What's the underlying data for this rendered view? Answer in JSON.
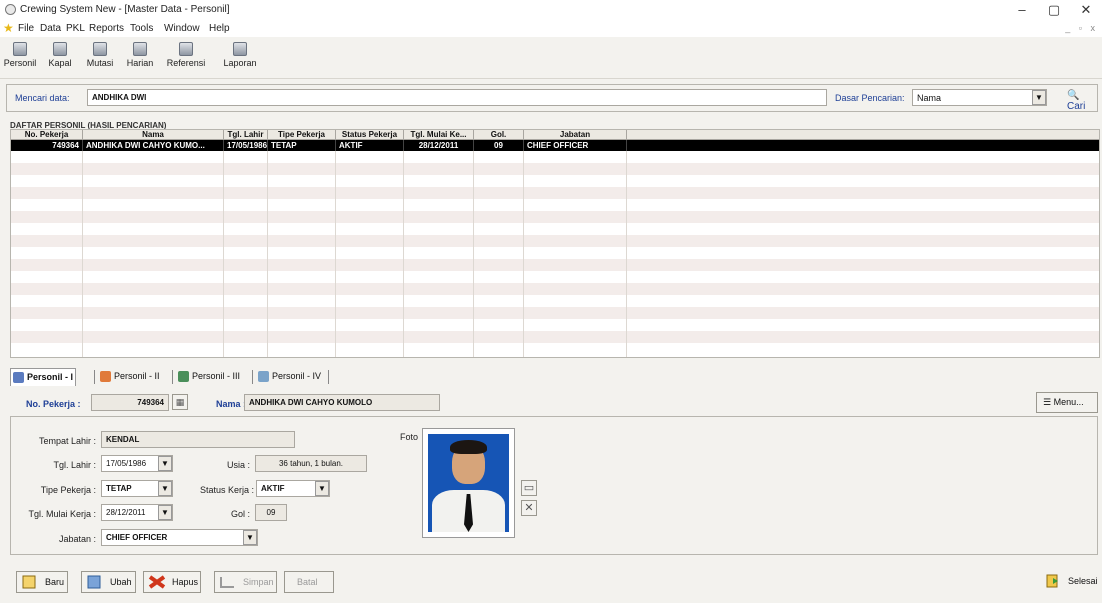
{
  "window": {
    "title": "Crewing System New - [Master Data - Personil]",
    "minimize": "–",
    "maximize": "▢",
    "close": "✕"
  },
  "menu": [
    "File",
    "Data",
    "PKL",
    "Reports",
    "Tools",
    "Window",
    "Help"
  ],
  "mdi_controls": "_ ▫ x",
  "toolbar": [
    "Personil",
    "Kapal",
    "Mutasi",
    "Harian",
    "Referensi",
    "Laporan"
  ],
  "search": {
    "label": "Mencari data:",
    "value": "ANDHIKA DWI",
    "basis_label": "Dasar Pencarian:",
    "basis_value": "Nama",
    "button": "Cari"
  },
  "grid": {
    "caption": "DAFTAR PERSONIL (HASIL PENCARIAN)",
    "columns": [
      "No. Pekerja",
      "Nama",
      "Tgl. Lahir",
      "Tipe Pekerja",
      "Status Pekerja",
      "Tgl. Mulai Ke...",
      "Gol.",
      "Jabatan"
    ],
    "rows": [
      [
        "749364",
        "ANDHIKA DWI CAHYO KUMO...",
        "17/05/1986",
        "TETAP",
        "AKTIF",
        "28/12/2011",
        "09",
        "CHIEF OFFICER"
      ]
    ]
  },
  "tabs": [
    "Personil - I",
    "Personil - II",
    "Personil - III",
    "Personil - IV"
  ],
  "detail": {
    "no_pekerja_label": "No. Pekerja :",
    "no_pekerja": "749364",
    "nama_label": "Nama :",
    "nama": "ANDHIKA DWI CAHYO KUMOLO",
    "menu_button": "Menu...",
    "tempat_lahir_label": "Tempat Lahir :",
    "tempat_lahir": "KENDAL",
    "tgl_lahir_label": "Tgl. Lahir :",
    "tgl_lahir": "17/05/1986",
    "usia_label": "Usia :",
    "usia": "36 tahun, 1 bulan.",
    "tipe_pekerja_label": "Tipe Pekerja :",
    "tipe_pekerja": "TETAP",
    "status_kerja_label": "Status Kerja :",
    "status_kerja": "AKTIF",
    "tgl_mulai_label": "Tgl. Mulai Kerja :",
    "tgl_mulai": "28/12/2011",
    "gol_label": "Gol :",
    "gol": "09",
    "jabatan_label": "Jabatan :",
    "jabatan": "CHIEF OFFICER",
    "foto_label": "Foto"
  },
  "buttons": {
    "baru": "Baru",
    "ubah": "Ubah",
    "hapus": "Hapus",
    "simpan": "Simpan",
    "batal": "Batal",
    "selesai": "Selesai"
  },
  "colors": {
    "accent": "#1e3f96",
    "selected_row": "#000000",
    "stripe": "#f3ecea"
  }
}
